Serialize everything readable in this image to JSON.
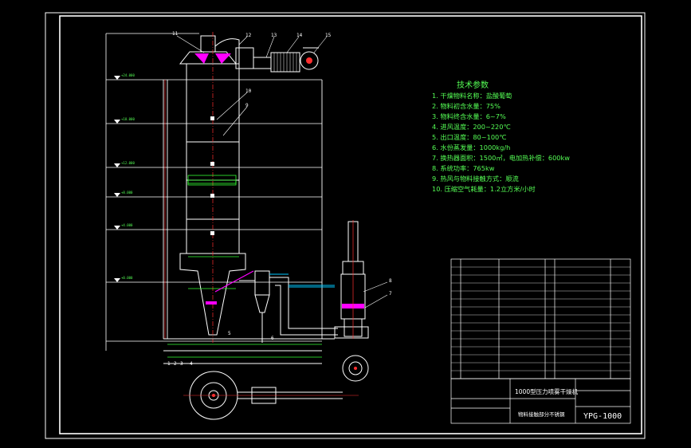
{
  "drawing": {
    "title_cn": "技术参数",
    "params": [
      "1. 干燥物料名称：盐酸葡萄",
      "2. 物料初含水量：75%",
      "3. 物料终含水量：6~7%",
      "4. 进风温度：200~220℃",
      "5. 出口温度：80~100℃",
      "6. 水份蒸发量：1000kg/h",
      "7. 换热器面积：1500㎡，电加热补偿：600kw",
      "8. 系统功率：765kw",
      "9. 热风与物料接触方式：顺流",
      "10. 压缩空气耗量：1.2立方米/小时"
    ],
    "callouts": [
      "11",
      "12",
      "13",
      "14",
      "15",
      "10",
      "9",
      "8",
      "7",
      "6",
      "5",
      "4",
      "3",
      "2",
      "1"
    ],
    "title_block": {
      "product_name": "1000型压力喷雾干燥机",
      "drawing_name": "物料接触部分不锈钢",
      "drawing_number": "YPG-1000"
    },
    "colors": {
      "frame": "#ffffff",
      "outline": "#ffffff",
      "text": "#55ff55",
      "magenta": "#ff00ff",
      "red": "#ff3030",
      "cyan": "#00c8ff",
      "green": "#33ff33",
      "yellow": "#ffff00"
    }
  }
}
